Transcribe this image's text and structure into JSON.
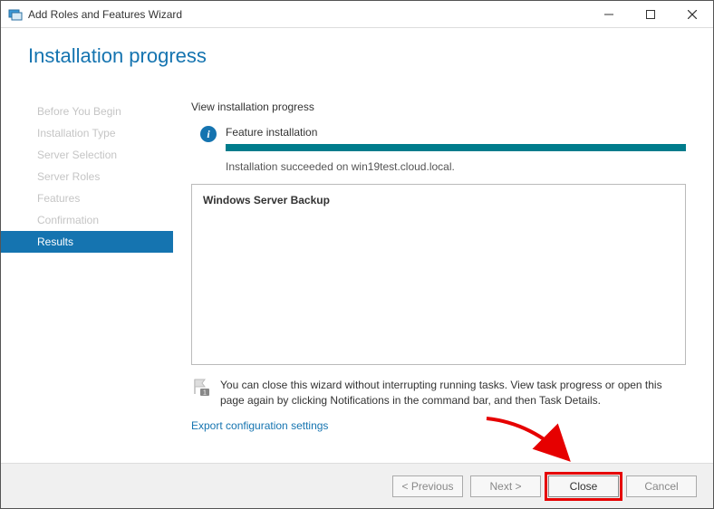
{
  "window": {
    "title": "Add Roles and Features Wizard"
  },
  "header": {
    "title": "Installation progress"
  },
  "sidebar": {
    "items": [
      {
        "label": "Before You Begin"
      },
      {
        "label": "Installation Type"
      },
      {
        "label": "Server Selection"
      },
      {
        "label": "Server Roles"
      },
      {
        "label": "Features"
      },
      {
        "label": "Confirmation"
      },
      {
        "label": "Results"
      }
    ],
    "active_index": 6
  },
  "main": {
    "section_title": "View installation progress",
    "status_label": "Feature installation",
    "status_message": "Installation succeeded on win19test.cloud.local.",
    "feature_list": "Windows Server Backup",
    "note_text": "You can close this wizard without interrupting running tasks. View task progress or open this page again by clicking Notifications in the command bar, and then Task Details.",
    "export_link": "Export configuration settings"
  },
  "footer": {
    "previous": "< Previous",
    "next": "Next >",
    "close": "Close",
    "cancel": "Cancel"
  }
}
